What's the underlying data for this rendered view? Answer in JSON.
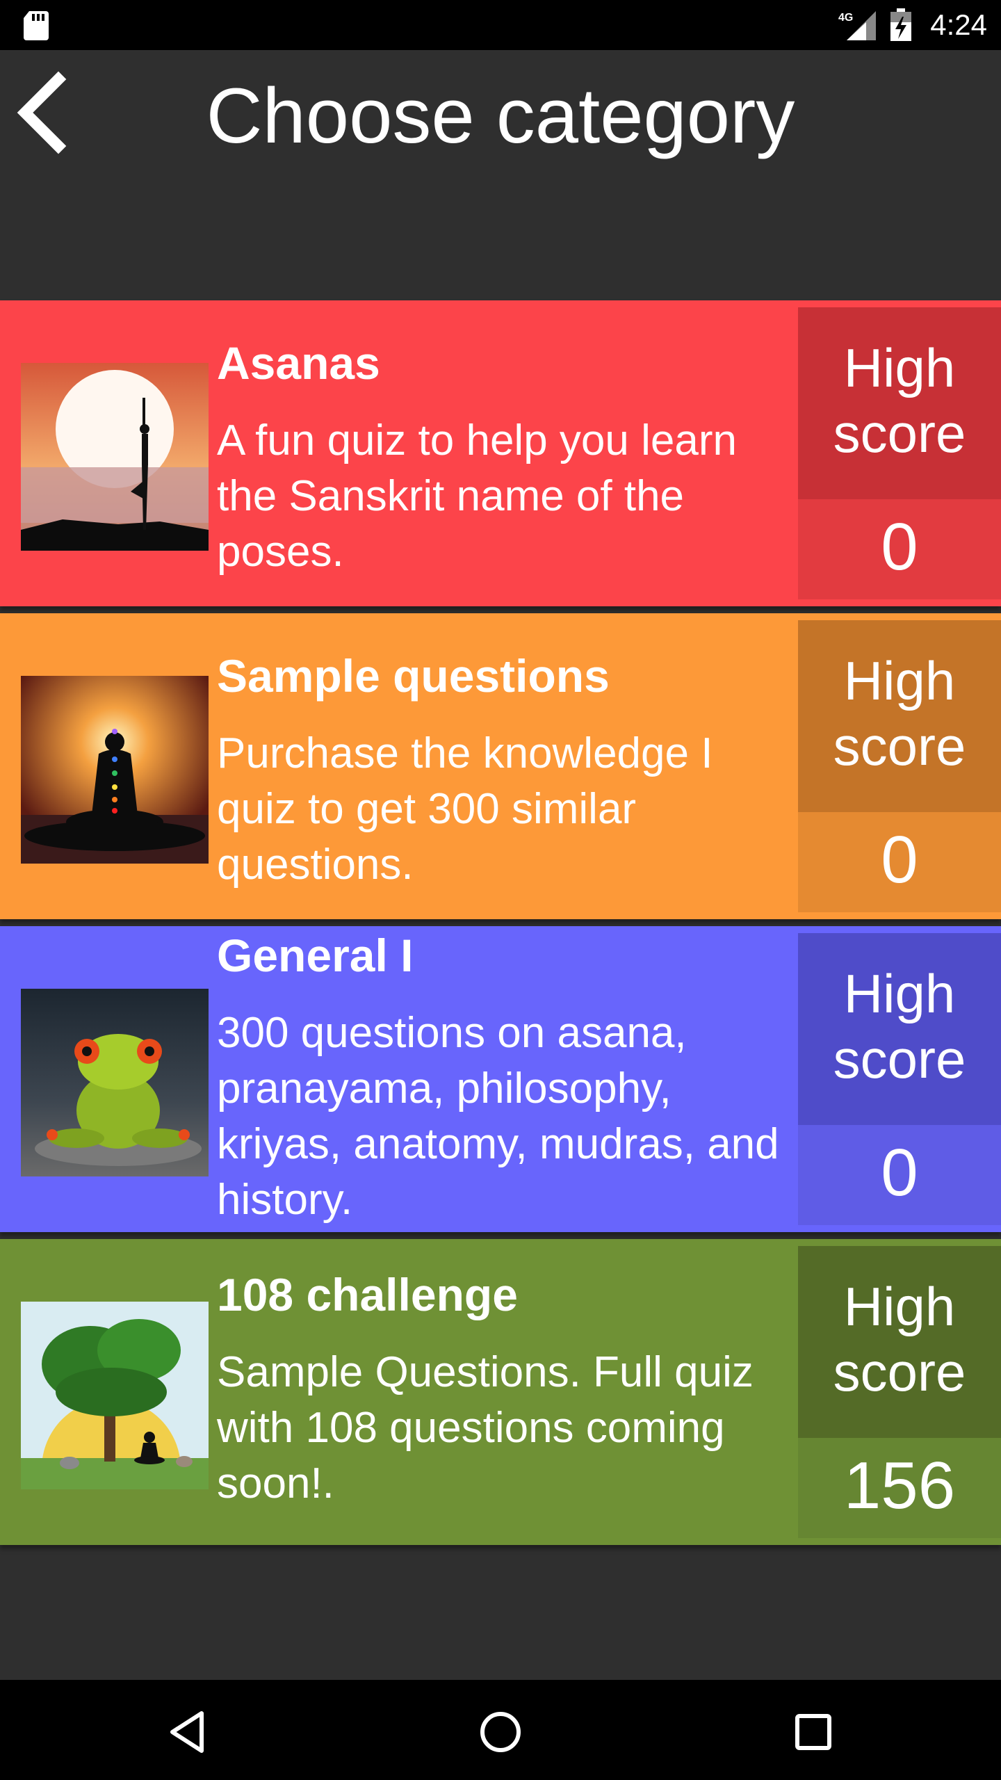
{
  "status_bar": {
    "time": "4:24",
    "network": "4G",
    "icons": [
      "sd-card-icon",
      "signal-icon",
      "battery-icon"
    ]
  },
  "header": {
    "title": "Choose category",
    "back_icon": "chevron-left-icon"
  },
  "categories": [
    {
      "title": "Asanas",
      "description": "A fun quiz to help you learn the Sanskrit name of the poses.",
      "high_score_label": "High score",
      "high_score": "0",
      "color": "#fc444a",
      "score_label_color": "#c73036",
      "score_value_color": "#e23b40",
      "image": "sunset-yoga-silhouette"
    },
    {
      "title": "Sample questions",
      "description": "Purchase the knowledge I quiz to get 300 similar questions.",
      "high_score_label": "High score",
      "high_score": "0",
      "color": "#fd9938",
      "score_label_color": "#c47428",
      "score_value_color": "#e58a31",
      "image": "meditation-chakras-silhouette"
    },
    {
      "title": "General I",
      "description": "300 questions on asana, pranayama, philosophy, kriyas, anatomy, mudras, and history.",
      "high_score_label": "High score",
      "high_score": "0",
      "color": "#6865fc",
      "score_label_color": "#4f4cc9",
      "score_value_color": "#5f5ce6",
      "image": "frog-meditating"
    },
    {
      "title": "108 challenge",
      "description": "Sample Questions. Full quiz with 108 questions coming soon!.",
      "high_score_label": "High score",
      "high_score": "156",
      "color": "#6f9135",
      "score_label_color": "#546b27",
      "score_value_color": "#668632",
      "image": "tree-meditation"
    }
  ],
  "nav_bar": {
    "icons": [
      "back-triangle-icon",
      "home-circle-icon",
      "recents-square-icon"
    ]
  }
}
